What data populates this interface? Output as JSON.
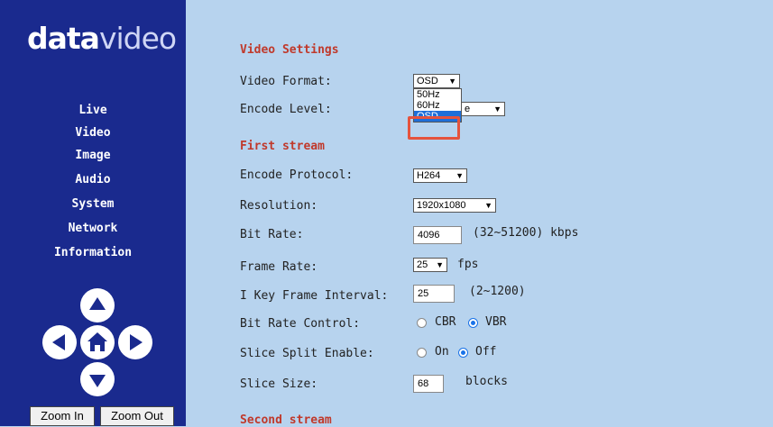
{
  "logo": {
    "bold": "data",
    "thin": "video"
  },
  "nav": [
    "Live",
    "Video",
    "Image",
    "Audio",
    "System",
    "Network",
    "Information"
  ],
  "zoom": {
    "in": "Zoom In",
    "out": "Zoom Out"
  },
  "sections": {
    "video": "Video Settings",
    "first": "First stream",
    "second": "Second stream"
  },
  "fields": {
    "video_format": {
      "label": "Video Format:",
      "value": "OSD"
    },
    "encode_level": {
      "label": "Encode Level:",
      "value": "e"
    },
    "encode_protocol": {
      "label": "Encode Protocol:",
      "value": "H264"
    },
    "resolution": {
      "label": "Resolution:",
      "value": "1920x1080"
    },
    "bit_rate": {
      "label": "Bit Rate:",
      "value": "4096",
      "unit": "(32~51200) kbps"
    },
    "frame_rate": {
      "label": "Frame Rate:",
      "value": "25",
      "unit": "fps"
    },
    "key_frame": {
      "label": "I Key Frame Interval:",
      "value": "25",
      "unit": "(2~1200)"
    },
    "bit_rate_control": {
      "label": "Bit Rate Control:",
      "options": [
        "CBR",
        "VBR"
      ],
      "selected": "VBR"
    },
    "slice_split": {
      "label": "Slice Split Enable:",
      "options": [
        "On",
        "Off"
      ],
      "selected": "Off"
    },
    "slice_size": {
      "label": "Slice Size:",
      "value": "68",
      "unit": "blocks"
    }
  },
  "dropdown_options": [
    "50Hz",
    "60Hz",
    "OSD"
  ],
  "dropdown_selected": "OSD",
  "colors": {
    "sidebar": "#1a2a8e",
    "background": "#b7d3ee",
    "heading": "#c0392b",
    "highlight": "#e5533d",
    "selected_option": "#1e6fd9"
  },
  "icons": [
    "arrow-up-icon",
    "arrow-left-icon",
    "home-icon",
    "arrow-right-icon",
    "arrow-down-icon",
    "chevron-down-icon"
  ]
}
